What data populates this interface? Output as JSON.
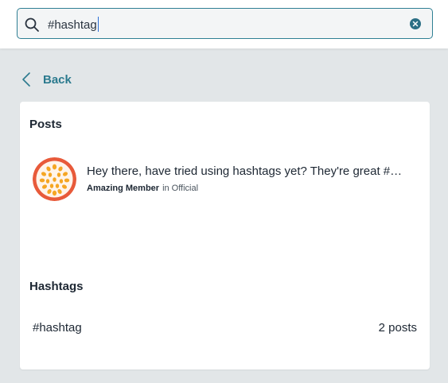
{
  "search": {
    "value": "#hashtag",
    "icon": "search-icon",
    "clear_icon": "clear-icon"
  },
  "nav": {
    "back_label": "Back",
    "back_icon": "chevron-left-icon"
  },
  "results": {
    "posts_title": "Posts",
    "posts": [
      {
        "text": "Hey there, have tried using hashtags yet? They're great #…",
        "author": "Amazing Member",
        "in_label": "in",
        "community": "Official",
        "avatar_icon": "avatar-icon"
      }
    ],
    "hashtags_title": "Hashtags",
    "hashtags": [
      {
        "name": "#hashtag",
        "count": "2 posts"
      }
    ]
  },
  "colors": {
    "accent": "#2b7a8e",
    "background": "#e2e6e8",
    "avatar_ring": "#e85a3a",
    "avatar_dots": "#f5a623"
  }
}
